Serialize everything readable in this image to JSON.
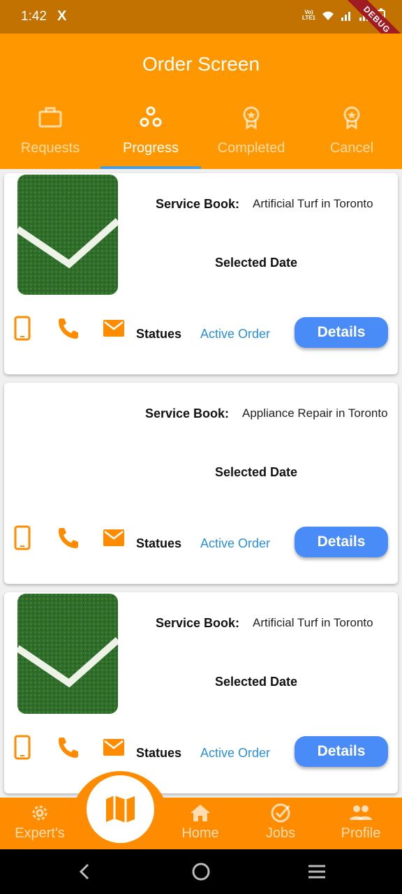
{
  "status_bar": {
    "time": "1:42",
    "x_glyph": "X",
    "volte": "Vo) LTE1",
    "debug": "DEBUG"
  },
  "app_bar": {
    "title": "Order Screen"
  },
  "tabs": [
    {
      "label": "Requests",
      "icon": "briefcase-icon",
      "active": false
    },
    {
      "label": "Progress",
      "icon": "bubbles-icon",
      "active": true
    },
    {
      "label": "Completed",
      "icon": "award-icon",
      "active": false
    },
    {
      "label": "Cancel",
      "icon": "award-icon",
      "active": false
    }
  ],
  "orders": [
    {
      "service_label": "Service Book:",
      "service": "Artificial Turf in Toronto",
      "date_label": "Selected Date",
      "status_label": "Statues",
      "status": "Active Order",
      "button": "Details",
      "image": "turf-image"
    },
    {
      "service_label": "Service Book:",
      "service": "Appliance Repair in Toronto",
      "date_label": "Selected Date",
      "status_label": "Statues",
      "status": "Active Order",
      "button": "Details",
      "image": null
    },
    {
      "service_label": "Service Book:",
      "service": "Artificial Turf in Toronto",
      "date_label": "Selected Date",
      "status_label": "Statues",
      "status": "Active Order",
      "button": "Details",
      "image": "turf-image"
    }
  ],
  "bottom_nav": [
    {
      "label": "Expert's",
      "icon": "gear-icon"
    },
    {
      "label": "",
      "icon": "map-icon"
    },
    {
      "label": "Home",
      "icon": "home-icon"
    },
    {
      "label": "Jobs",
      "icon": "check-circle-icon"
    },
    {
      "label": "Profile",
      "icon": "people-icon"
    }
  ],
  "colors": {
    "status_bar": "#c27200",
    "app_bar": "#ff9800",
    "accent": "#ff8c00",
    "indicator": "#4a9ee0",
    "button": "#4a8cf7",
    "link": "#2a8fd6"
  }
}
